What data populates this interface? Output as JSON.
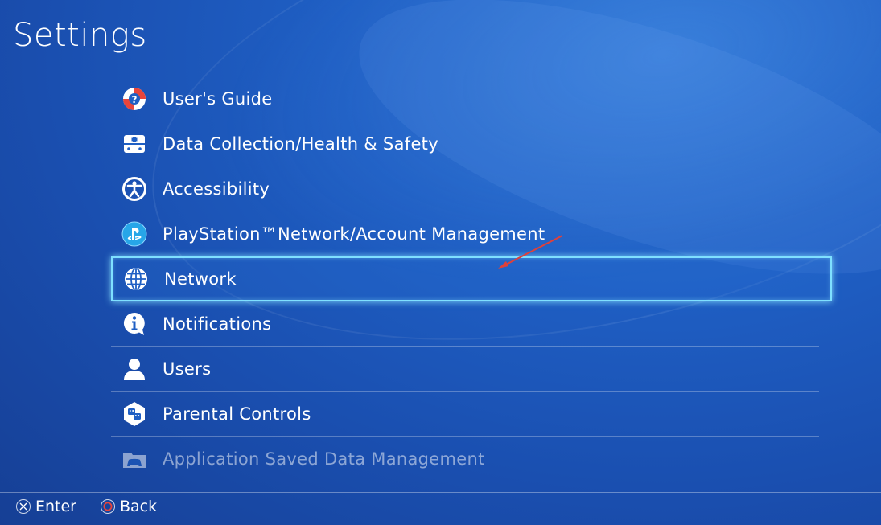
{
  "header": {
    "title": "Settings"
  },
  "menu": {
    "items": [
      {
        "label": "User's Guide",
        "icon": "lifebuoy-help-icon"
      },
      {
        "label": "Data Collection/Health & Safety",
        "icon": "first-aid-icon"
      },
      {
        "label": "Accessibility",
        "icon": "accessibility-icon"
      },
      {
        "label": "PlayStation™Network/Account Management",
        "icon": "playstation-icon"
      },
      {
        "label": "Network",
        "icon": "globe-icon",
        "selected": true
      },
      {
        "label": "Notifications",
        "icon": "info-bubble-icon"
      },
      {
        "label": "Users",
        "icon": "user-icon"
      },
      {
        "label": "Parental Controls",
        "icon": "parental-controls-icon"
      },
      {
        "label": "Application Saved Data Management",
        "icon": "folder-controller-icon"
      }
    ]
  },
  "footer": {
    "enter_label": "Enter",
    "back_label": "Back"
  },
  "colors": {
    "background": "#1f5fc4",
    "selection_outline": "#7fe0ff",
    "annotation_arrow": "#e0403a",
    "back_button": "#e8453c"
  }
}
